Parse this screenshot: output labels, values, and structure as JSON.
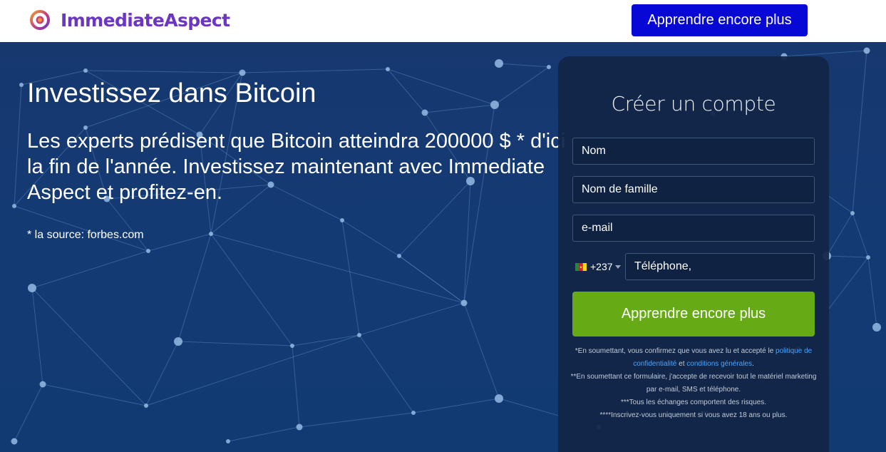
{
  "header": {
    "brand": "ImmediateAspect",
    "cta_label": "Apprendre encore plus",
    "brand_color": "#6b36c2",
    "cta_color": "#0707d6"
  },
  "hero": {
    "title": "Investissez dans Bitcoin",
    "subtitle": "Les experts prédisent que Bitcoin atteindra 200000 $ * d'ici la fin de l'année. Investissez maintenant avec Immediate Aspect et profitez-en.",
    "source": "* la source: forbes.com",
    "background_color": "#143a74"
  },
  "form": {
    "title": "Créer un compte",
    "first_name_placeholder": "Nom",
    "last_name_placeholder": "Nom de famille",
    "email_placeholder": "e-mail",
    "phone_prefix": "+237",
    "phone_flag_icon": "cameroon-flag-icon",
    "phone_placeholder": "Téléphone,",
    "submit_label": "Apprendre encore plus",
    "submit_color": "#66ab16",
    "disclaimer": {
      "line1_prefix": "*En soumettant, vous confirmez que vous avez lu et accepté le ",
      "privacy_link": "politique de confidentialité",
      "line1_and": " et ",
      "terms_link": "conditions générales",
      "line1_end": ".",
      "line2": "**En soumettant ce formulaire, j'accepte de recevoir tout le matériel marketing par e-mail, SMS et téléphone.",
      "line3": "***Tous les échanges comportent des risques.",
      "line4": "****Inscrivez-vous uniquement si vous avez 18 ans ou plus."
    },
    "link_color": "#4aa3ff"
  }
}
